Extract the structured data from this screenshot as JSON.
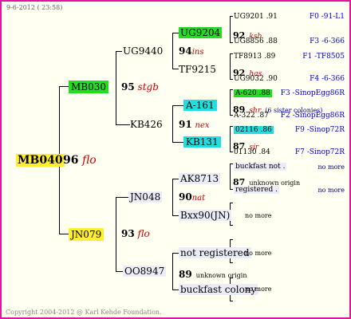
{
  "header": {
    "date": "9-6-2012 ( 23:58)"
  },
  "footer": {
    "copyright": "Copyright 2004-2012 @ Karl Kehde Foundation."
  },
  "root": {
    "name": "MB040",
    "num": "96",
    "sub": "flo"
  },
  "gen1": {
    "upper": {
      "name": "MB030",
      "num": "95",
      "sub": "stgb"
    },
    "lower": {
      "name": "JN079",
      "num": "93",
      "sub": "flo"
    }
  },
  "gen2": {
    "ug9440": {
      "name": "UG9440",
      "num": "94",
      "sub": "ins"
    },
    "kb426": {
      "name": "KB426",
      "num": "91",
      "sub": "nex"
    },
    "jn048": {
      "name": "JN048",
      "num": "90",
      "sub": "nat"
    },
    "oo8947": {
      "name": "OO8947",
      "num": "89",
      "sub": "unknown origin"
    }
  },
  "gen3": {
    "ug9204": {
      "name": "UG9204",
      "num": "92",
      "sub": "ksb"
    },
    "tf9215": {
      "name": "TF9215",
      "num": "92",
      "sub": "has"
    },
    "a161": {
      "name": "A-161",
      "num": "89",
      "sub": "shr",
      "extra": "(6 sister colonies)"
    },
    "kb131": {
      "name": "KB131",
      "num": "87",
      "sub": "sjr"
    },
    "ak8713": {
      "name": "AK8713",
      "num": "87",
      "sub": "unknown origin"
    },
    "bxx90": {
      "name": "Bxx90(JN)"
    },
    "notreg": {
      "name": "not registered"
    },
    "bfcol": {
      "name": "buckfast colony"
    }
  },
  "gen4": [
    {
      "name": "UG9201",
      "val": ".91",
      "right": "F0 -91-L1"
    },
    {
      "name": "UG8856",
      "val": ".88",
      "right": "F3 -6-366"
    },
    {
      "name": "TF8913",
      "val": ".89",
      "right": "F1 -TF8505"
    },
    {
      "name": "UG9032",
      "val": ".90",
      "right": "F4 -6-366"
    },
    {
      "name": "A-620",
      "val": ".88",
      "right": "F3 -SinopEgg86R"
    },
    {
      "name": "A-322",
      "val": ".87",
      "right": "F2 -SinopEgg86R"
    },
    {
      "name": "02116",
      "val": ".86",
      "right": "F9 -Sinop72R"
    },
    {
      "name": "01130",
      "val": ".84",
      "right": "F7 -Sinop72R"
    },
    {
      "name": "buckfast not",
      "val": ".",
      "right": "no more"
    },
    {
      "name": "registered",
      "val": ".",
      "right": "no more"
    }
  ],
  "no_more": "no more"
}
